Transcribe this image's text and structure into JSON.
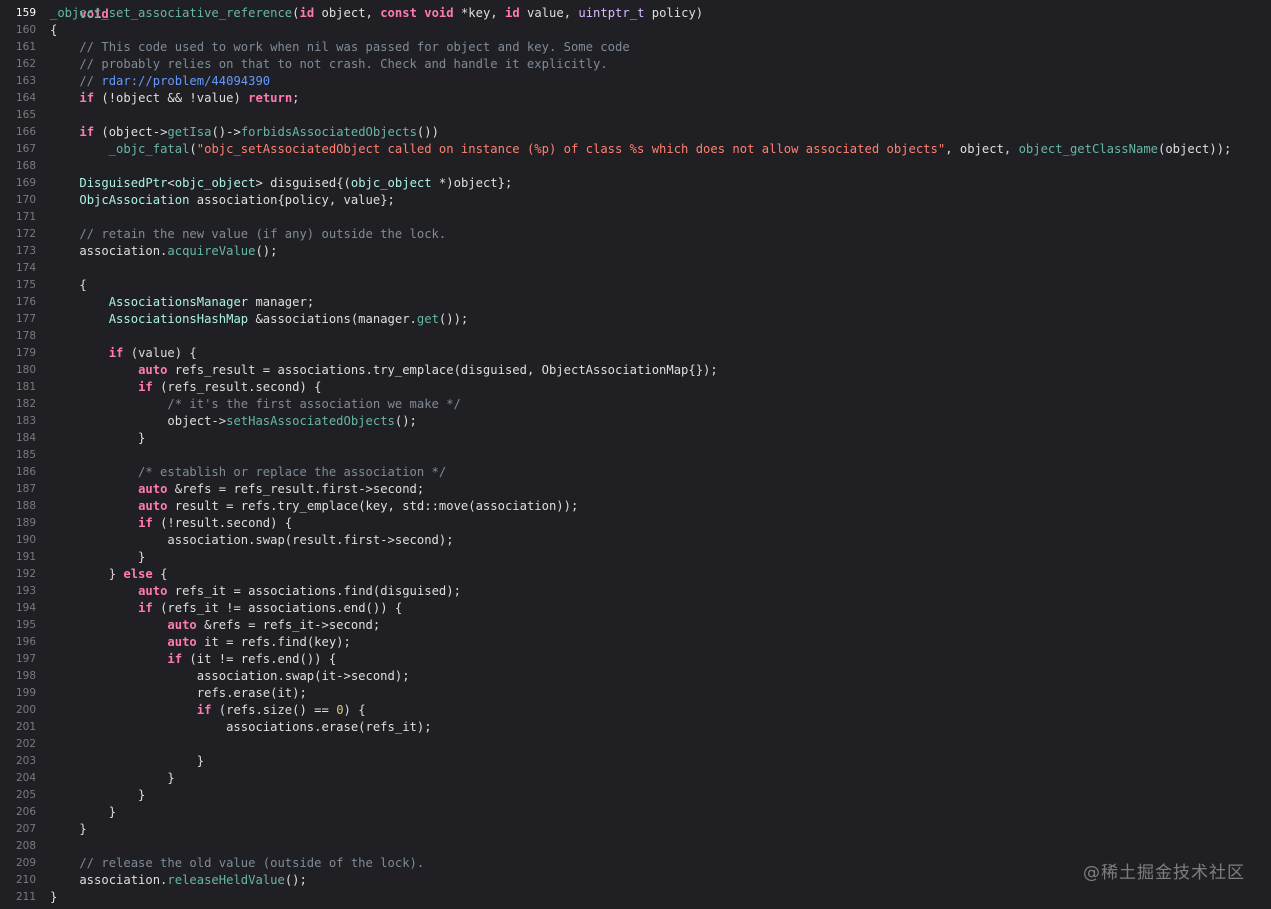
{
  "editor": {
    "cut_line": "void",
    "current_line": 159,
    "lines": [
      {
        "n": "159",
        "t": [
          [
            "fn",
            "_object_set_associative_reference"
          ],
          [
            "txt",
            "("
          ],
          [
            "kw",
            "id"
          ],
          [
            "txt",
            " object, "
          ],
          [
            "kw",
            "const"
          ],
          [
            "txt",
            " "
          ],
          [
            "kw",
            "void"
          ],
          [
            "txt",
            " *key, "
          ],
          [
            "kw",
            "id"
          ],
          [
            "txt",
            " value, "
          ],
          [
            "ty",
            "uintptr_t"
          ],
          [
            "txt",
            " policy)"
          ]
        ]
      },
      {
        "n": "160",
        "t": [
          [
            "txt",
            "{"
          ]
        ]
      },
      {
        "n": "161",
        "t": [
          [
            "cm",
            "    // This code used to work when nil was passed for object and key. Some code"
          ]
        ]
      },
      {
        "n": "162",
        "t": [
          [
            "cm",
            "    // probably relies on that to not crash. Check and handle it explicitly."
          ]
        ]
      },
      {
        "n": "163",
        "t": [
          [
            "cm",
            "    // "
          ],
          [
            "url",
            "rdar://problem/44094390"
          ]
        ]
      },
      {
        "n": "164",
        "t": [
          [
            "txt",
            "    "
          ],
          [
            "kw",
            "if"
          ],
          [
            "txt",
            " (!object && !value) "
          ],
          [
            "kw",
            "return"
          ],
          [
            "txt",
            ";"
          ]
        ]
      },
      {
        "n": "165",
        "t": []
      },
      {
        "n": "166",
        "t": [
          [
            "txt",
            "    "
          ],
          [
            "kw",
            "if"
          ],
          [
            "txt",
            " (object->"
          ],
          [
            "fn",
            "getIsa"
          ],
          [
            "txt",
            "()->"
          ],
          [
            "fn",
            "forbidsAssociatedObjects"
          ],
          [
            "txt",
            "())"
          ]
        ]
      },
      {
        "n": "167",
        "t": [
          [
            "txt",
            "        "
          ],
          [
            "fn",
            "_objc_fatal"
          ],
          [
            "txt",
            "("
          ],
          [
            "str",
            "\"objc_setAssociatedObject called on instance (%p) of class %s which does not allow associated objects\""
          ],
          [
            "txt",
            ", object, "
          ],
          [
            "fn",
            "object_getClassName"
          ],
          [
            "txt",
            "(object));"
          ]
        ]
      },
      {
        "n": "168",
        "t": []
      },
      {
        "n": "169",
        "t": [
          [
            "txt",
            "    "
          ],
          [
            "cls",
            "DisguisedPtr"
          ],
          [
            "txt",
            "<"
          ],
          [
            "cls",
            "objc_object"
          ],
          [
            "txt",
            "> disguised{("
          ],
          [
            "cls",
            "objc_object"
          ],
          [
            "txt",
            " *)object};"
          ]
        ]
      },
      {
        "n": "170",
        "t": [
          [
            "txt",
            "    "
          ],
          [
            "cls",
            "ObjcAssociation"
          ],
          [
            "txt",
            " association{policy, value};"
          ]
        ]
      },
      {
        "n": "171",
        "t": []
      },
      {
        "n": "172",
        "t": [
          [
            "cm",
            "    // retain the new value (if any) outside the lock."
          ]
        ]
      },
      {
        "n": "173",
        "t": [
          [
            "txt",
            "    association."
          ],
          [
            "fn",
            "acquireValue"
          ],
          [
            "txt",
            "();"
          ]
        ]
      },
      {
        "n": "174",
        "t": []
      },
      {
        "n": "175",
        "t": [
          [
            "txt",
            "    {"
          ]
        ]
      },
      {
        "n": "176",
        "t": [
          [
            "txt",
            "        "
          ],
          [
            "cls",
            "AssociationsManager"
          ],
          [
            "txt",
            " manager;"
          ]
        ]
      },
      {
        "n": "177",
        "t": [
          [
            "txt",
            "        "
          ],
          [
            "cls",
            "AssociationsHashMap"
          ],
          [
            "txt",
            " &associations(manager."
          ],
          [
            "fn",
            "get"
          ],
          [
            "txt",
            "());"
          ]
        ]
      },
      {
        "n": "178",
        "t": []
      },
      {
        "n": "179",
        "t": [
          [
            "txt",
            "        "
          ],
          [
            "kw",
            "if"
          ],
          [
            "txt",
            " (value) {"
          ]
        ]
      },
      {
        "n": "180",
        "t": [
          [
            "txt",
            "            "
          ],
          [
            "kw",
            "auto"
          ],
          [
            "txt",
            " refs_result = associations.try_emplace(disguised, ObjectAssociationMap{});"
          ]
        ]
      },
      {
        "n": "181",
        "t": [
          [
            "txt",
            "            "
          ],
          [
            "kw",
            "if"
          ],
          [
            "txt",
            " (refs_result.second) {"
          ]
        ]
      },
      {
        "n": "182",
        "t": [
          [
            "cm",
            "                /* it's the first association we make */"
          ]
        ]
      },
      {
        "n": "183",
        "t": [
          [
            "txt",
            "                object->"
          ],
          [
            "fn",
            "setHasAssociatedObjects"
          ],
          [
            "txt",
            "();"
          ]
        ]
      },
      {
        "n": "184",
        "t": [
          [
            "txt",
            "            }"
          ]
        ]
      },
      {
        "n": "185",
        "t": []
      },
      {
        "n": "186",
        "t": [
          [
            "cm",
            "            /* establish or replace the association */"
          ]
        ]
      },
      {
        "n": "187",
        "t": [
          [
            "txt",
            "            "
          ],
          [
            "kw",
            "auto"
          ],
          [
            "txt",
            " &refs = refs_result.first->second;"
          ]
        ]
      },
      {
        "n": "188",
        "t": [
          [
            "txt",
            "            "
          ],
          [
            "kw",
            "auto"
          ],
          [
            "txt",
            " result = refs.try_emplace(key, std::move(association));"
          ]
        ]
      },
      {
        "n": "189",
        "t": [
          [
            "txt",
            "            "
          ],
          [
            "kw",
            "if"
          ],
          [
            "txt",
            " (!result.second) {"
          ]
        ]
      },
      {
        "n": "190",
        "t": [
          [
            "txt",
            "                association.swap(result.first->second);"
          ]
        ]
      },
      {
        "n": "191",
        "t": [
          [
            "txt",
            "            }"
          ]
        ]
      },
      {
        "n": "192",
        "t": [
          [
            "txt",
            "        } "
          ],
          [
            "kw",
            "else"
          ],
          [
            "txt",
            " {"
          ]
        ]
      },
      {
        "n": "193",
        "t": [
          [
            "txt",
            "            "
          ],
          [
            "kw",
            "auto"
          ],
          [
            "txt",
            " refs_it = associations.find(disguised);"
          ]
        ]
      },
      {
        "n": "194",
        "t": [
          [
            "txt",
            "            "
          ],
          [
            "kw",
            "if"
          ],
          [
            "txt",
            " (refs_it != associations.end()) {"
          ]
        ]
      },
      {
        "n": "195",
        "t": [
          [
            "txt",
            "                "
          ],
          [
            "kw",
            "auto"
          ],
          [
            "txt",
            " &refs = refs_it->second;"
          ]
        ]
      },
      {
        "n": "196",
        "t": [
          [
            "txt",
            "                "
          ],
          [
            "kw",
            "auto"
          ],
          [
            "txt",
            " it = refs.find(key);"
          ]
        ]
      },
      {
        "n": "197",
        "t": [
          [
            "txt",
            "                "
          ],
          [
            "kw",
            "if"
          ],
          [
            "txt",
            " (it != refs.end()) {"
          ]
        ]
      },
      {
        "n": "198",
        "t": [
          [
            "txt",
            "                    association.swap(it->second);"
          ]
        ]
      },
      {
        "n": "199",
        "t": [
          [
            "txt",
            "                    refs.erase(it);"
          ]
        ]
      },
      {
        "n": "200",
        "t": [
          [
            "txt",
            "                    "
          ],
          [
            "kw",
            "if"
          ],
          [
            "txt",
            " (refs.size() == "
          ],
          [
            "num",
            "0"
          ],
          [
            "txt",
            ") {"
          ]
        ]
      },
      {
        "n": "201",
        "t": [
          [
            "txt",
            "                        associations.erase(refs_it);"
          ]
        ]
      },
      {
        "n": "202",
        "t": []
      },
      {
        "n": "203",
        "t": [
          [
            "txt",
            "                    }"
          ]
        ]
      },
      {
        "n": "204",
        "t": [
          [
            "txt",
            "                }"
          ]
        ]
      },
      {
        "n": "205",
        "t": [
          [
            "txt",
            "            }"
          ]
        ]
      },
      {
        "n": "206",
        "t": [
          [
            "txt",
            "        }"
          ]
        ]
      },
      {
        "n": "207",
        "t": [
          [
            "txt",
            "    }"
          ]
        ]
      },
      {
        "n": "208",
        "t": []
      },
      {
        "n": "209",
        "t": [
          [
            "cm",
            "    // release the old value (outside of the lock)."
          ]
        ]
      },
      {
        "n": "210",
        "t": [
          [
            "txt",
            "    association."
          ],
          [
            "fn",
            "releaseHeldValue"
          ],
          [
            "txt",
            "();"
          ]
        ]
      },
      {
        "n": "211",
        "t": [
          [
            "txt",
            "}"
          ]
        ]
      }
    ]
  },
  "watermark": "@稀土掘金技术社区",
  "colors": {
    "background": "#1f1f24",
    "keyword": "#ff7ab2",
    "type": "#dabaff",
    "class": "#acf2e4",
    "function": "#67b7a4",
    "string": "#ff8170",
    "number": "#d9c97c",
    "comment": "#7f8c98",
    "url": "#6699ff",
    "plain": "#dfdfe0"
  }
}
